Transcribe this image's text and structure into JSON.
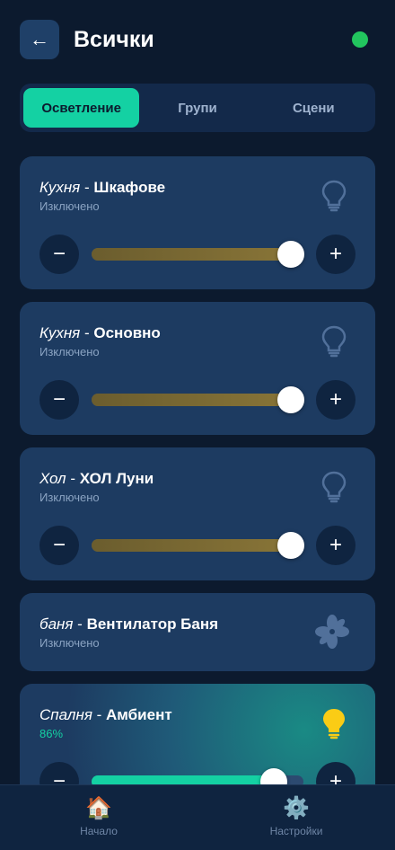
{
  "header": {
    "back_icon": "←",
    "title": "Всички",
    "status_color": "#22c55e"
  },
  "tabs": [
    {
      "label": "Осветление",
      "active": true
    },
    {
      "label": "Групи",
      "active": false
    },
    {
      "label": "Сцени",
      "active": false
    }
  ],
  "devices": [
    {
      "room": "Кухня",
      "separator": " - ",
      "name": "Шкафове",
      "status": "Изключено",
      "icon": "bulb-icon",
      "level_percent": 100,
      "has_slider": true,
      "on": false
    },
    {
      "room": "Кухня",
      "separator": " - ",
      "name": "Основно",
      "status": "Изключено",
      "icon": "bulb-icon",
      "level_percent": 100,
      "has_slider": true,
      "on": false
    },
    {
      "room": "Хол",
      "separator": " - ",
      "name": "ХОЛ Луни",
      "status": "Изключено",
      "icon": "bulb-icon",
      "level_percent": 100,
      "has_slider": true,
      "on": false
    },
    {
      "room": "баня",
      "separator": " - ",
      "name": "Вентилатор Баня",
      "status": "Изключено",
      "icon": "fan-icon",
      "has_slider": false,
      "on": false
    },
    {
      "room": "Спалня",
      "separator": " - ",
      "name": "Амбиент",
      "status": "86%",
      "icon": "bulb-icon",
      "level_percent": 86,
      "has_slider": true,
      "on": true
    }
  ],
  "controls": {
    "minus": "−",
    "plus": "+"
  },
  "nav": [
    {
      "label": "Начало",
      "icon": "🏠"
    },
    {
      "label": "Настройки",
      "icon": "⚙️"
    }
  ],
  "colors": {
    "accent": "#14d1a3",
    "card": "#1d3b61",
    "background": "#0c1a2e",
    "bulb_on": "#facc15",
    "icon_off": "#51709a"
  }
}
